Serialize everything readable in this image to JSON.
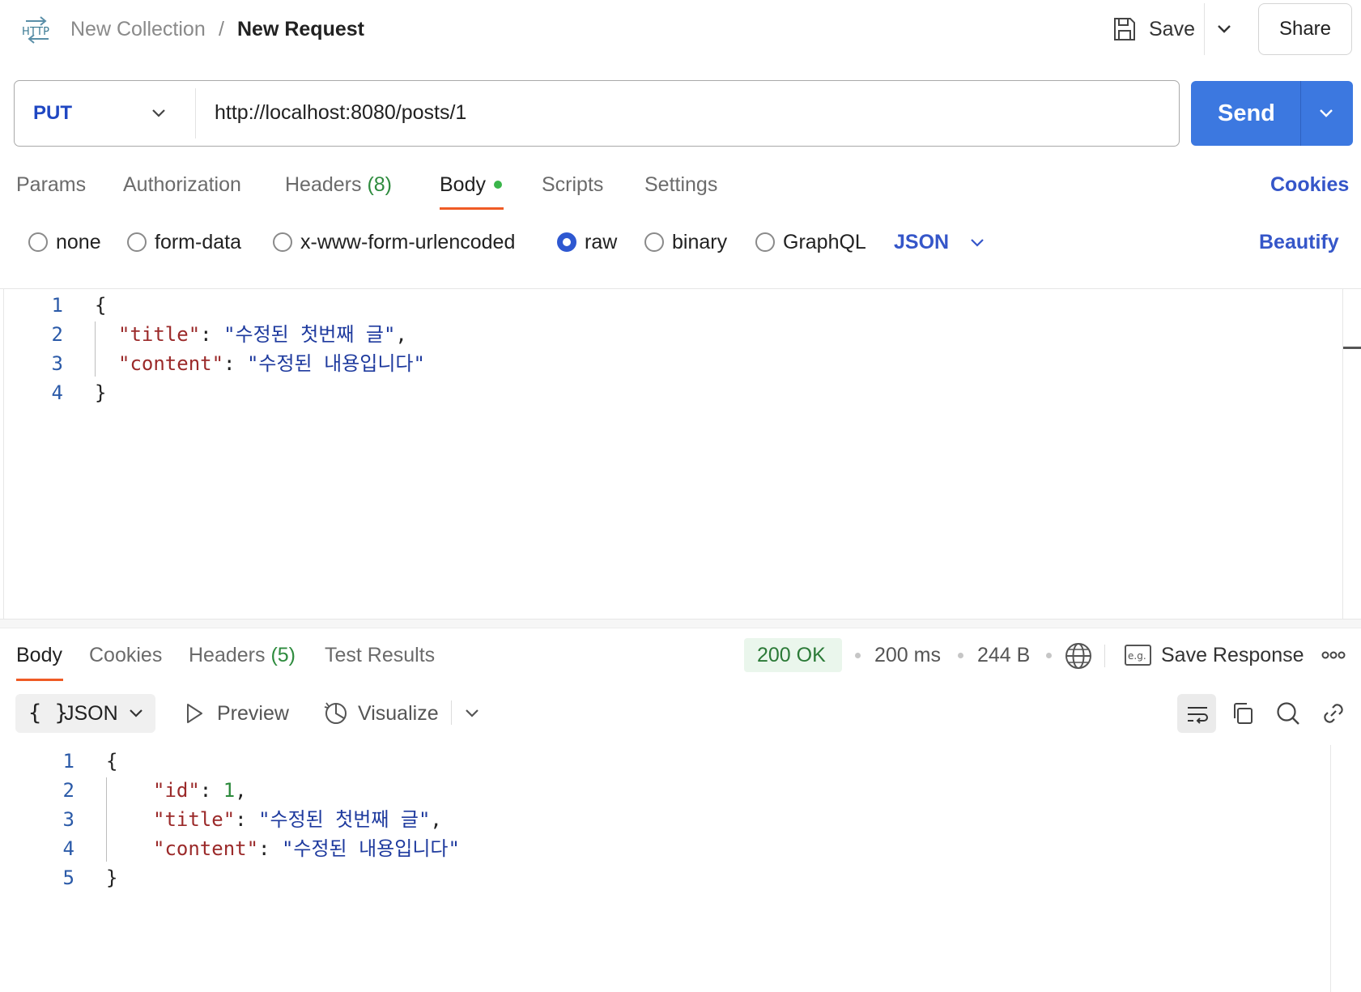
{
  "header": {
    "icon": "http-icon",
    "collection": "New Collection",
    "separator": "/",
    "request_name": "New Request",
    "save_label": "Save",
    "share_label": "Share"
  },
  "request": {
    "method": "PUT",
    "url": "http://localhost:8080/posts/1",
    "send_label": "Send"
  },
  "request_tabs": [
    {
      "label": "Params"
    },
    {
      "label": "Authorization"
    },
    {
      "label": "Headers",
      "count": "(8)"
    },
    {
      "label": "Body",
      "active": true
    },
    {
      "label": "Scripts"
    },
    {
      "label": "Settings"
    }
  ],
  "cookies_label": "Cookies",
  "body_types": [
    {
      "label": "none",
      "checked": false
    },
    {
      "label": "form-data",
      "checked": false
    },
    {
      "label": "x-www-form-urlencoded",
      "checked": false
    },
    {
      "label": "raw",
      "checked": true
    },
    {
      "label": "binary",
      "checked": false
    },
    {
      "label": "GraphQL",
      "checked": false
    }
  ],
  "raw_format": "JSON",
  "beautify_label": "Beautify",
  "request_body": {
    "line_numbers": [
      "1",
      "2",
      "3",
      "4"
    ],
    "open_brace": "{",
    "close_brace": "}",
    "fields": [
      {
        "key": "\"title\"",
        "colon": ": ",
        "value": "\"수정된 첫번째 글\"",
        "comma": ","
      },
      {
        "key": "\"content\"",
        "colon": ": ",
        "value": "\"수정된 내용입니다\"",
        "comma": ""
      }
    ]
  },
  "response": {
    "tabs": [
      {
        "label": "Body",
        "active": true
      },
      {
        "label": "Cookies"
      },
      {
        "label": "Headers",
        "count": "(5)"
      },
      {
        "label": "Test Results"
      }
    ],
    "status": "200 OK",
    "time": "200 ms",
    "size": "244 B",
    "save_response_label": "Save Response",
    "format_label": "JSON",
    "format_braces": "{ }",
    "preview_label": "Preview",
    "visualize_label": "Visualize",
    "body": {
      "line_numbers": [
        "1",
        "2",
        "3",
        "4",
        "5"
      ],
      "open_brace": "{",
      "close_brace": "}",
      "id_key": "\"id\"",
      "id_value": "1",
      "fields": [
        {
          "key": "\"title\"",
          "colon": ": ",
          "value": "\"수정된 첫번째 글\"",
          "comma": ","
        },
        {
          "key": "\"content\"",
          "colon": ": ",
          "value": "\"수정된 내용입니다\"",
          "comma": ""
        }
      ]
    }
  },
  "colors": {
    "accent_blue": "#3c78e0",
    "tab_underline": "#ef5b25",
    "status_green": "#2b7a37",
    "link_blue": "#3556c9"
  }
}
